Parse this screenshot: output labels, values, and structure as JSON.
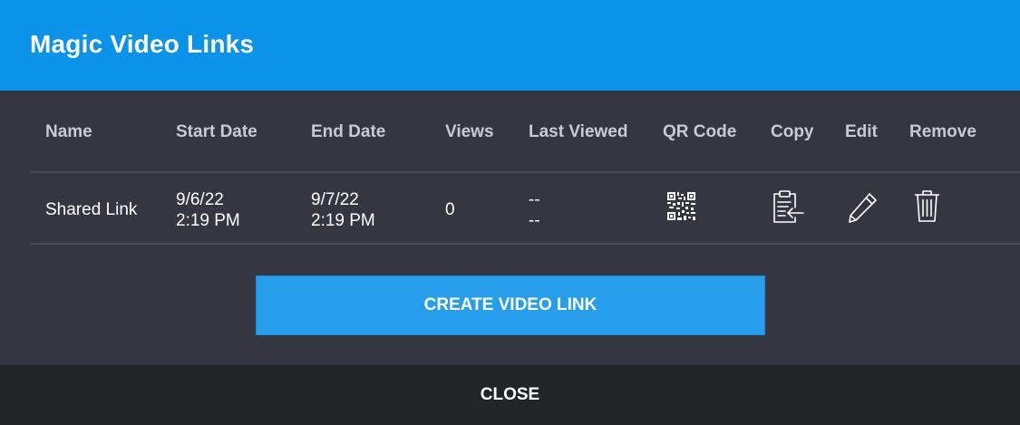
{
  "dialog": {
    "title": "Magic Video Links"
  },
  "table": {
    "headers": {
      "name": "Name",
      "start_date": "Start Date",
      "end_date": "End Date",
      "views": "Views",
      "last_viewed": "Last Viewed",
      "qr_code": "QR Code",
      "copy": "Copy",
      "edit": "Edit",
      "remove": "Remove"
    },
    "rows": [
      {
        "name": "Shared Link",
        "start_date": "9/6/22",
        "start_time": "2:19 PM",
        "end_date": "9/7/22",
        "end_time": "2:19 PM",
        "views": "0",
        "last_viewed_line1": "--",
        "last_viewed_line2": "--",
        "icons": {
          "qr": "qr-code-icon",
          "copy": "clipboard-copy-icon",
          "edit": "pencil-icon",
          "remove": "trash-icon"
        }
      }
    ]
  },
  "actions": {
    "create_label": "CREATE VIDEO LINK",
    "close_label": "CLOSE"
  },
  "colors": {
    "header": "#0b93ea",
    "body": "#343741",
    "button": "#279eec",
    "footer": "#222428"
  }
}
